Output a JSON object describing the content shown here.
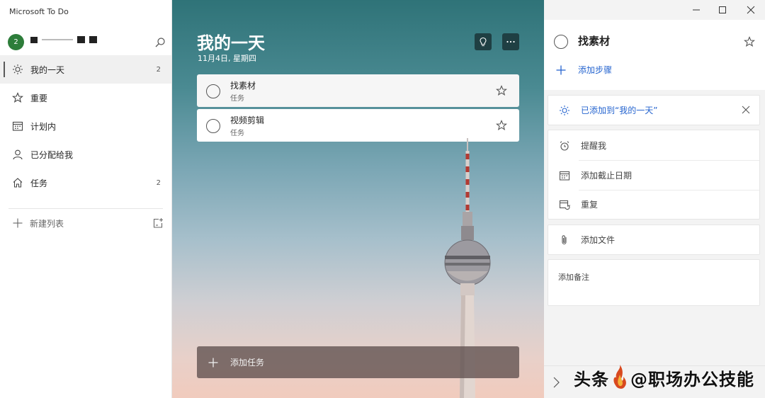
{
  "app": {
    "title": "Microsoft To Do"
  },
  "account": {
    "avatar_text": "2"
  },
  "sidebar": {
    "items": [
      {
        "label": "我的一天",
        "count": "2",
        "icon": "sun-icon",
        "active": true
      },
      {
        "label": "重要",
        "count": "",
        "icon": "star-icon"
      },
      {
        "label": "计划内",
        "count": "",
        "icon": "calendar-icon"
      },
      {
        "label": "已分配给我",
        "count": "",
        "icon": "person-icon"
      },
      {
        "label": "任务",
        "count": "2",
        "icon": "home-icon"
      }
    ],
    "new_list_label": "新建列表"
  },
  "main": {
    "title": "我的一天",
    "date": "11月4日, 星期四",
    "tasks": [
      {
        "name": "找素材",
        "list": "任务"
      },
      {
        "name": "视频剪辑",
        "list": "任务"
      }
    ],
    "add_task_label": "添加任务"
  },
  "detail": {
    "task_title": "找素材",
    "add_step_label": "添加步骤",
    "added_to_myday_label": "已添加到“我的一天”",
    "remind_label": "提醒我",
    "due_date_label": "添加截止日期",
    "repeat_label": "重复",
    "add_file_label": "添加文件",
    "note_placeholder": "添加备注"
  },
  "watermark": {
    "left": "头条",
    "right": "@职场办公技能"
  },
  "colors": {
    "accent": "#2564cf",
    "avatar": "#2d7d3a",
    "header_button": "#1f3f43"
  }
}
